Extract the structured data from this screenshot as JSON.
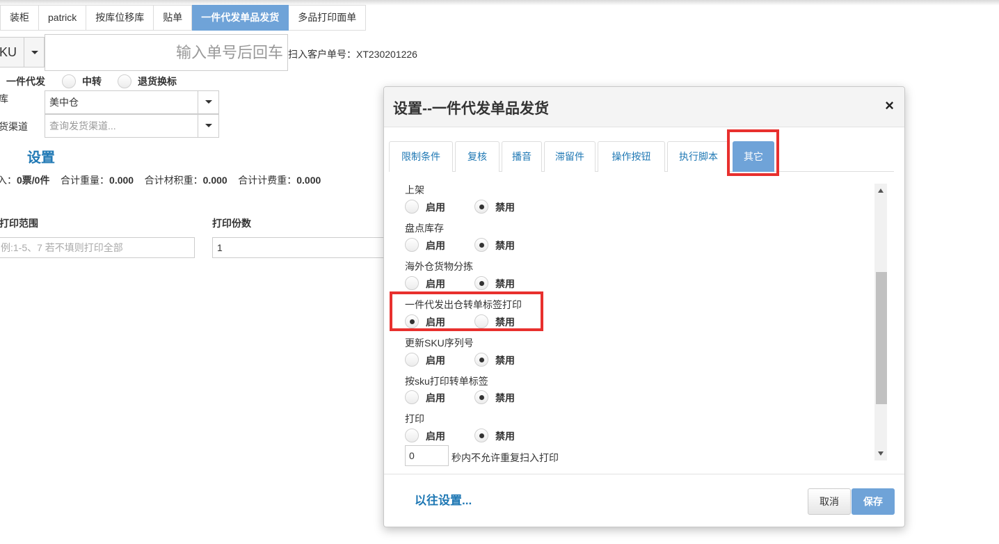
{
  "tabs": [
    {
      "label": "装柜"
    },
    {
      "label": "patrick"
    },
    {
      "label": "按库位移库"
    },
    {
      "label": "贴单"
    },
    {
      "label": "一件代发单品发货",
      "active": true
    },
    {
      "label": "多品打印面单"
    }
  ],
  "scan": {
    "mode_label": "KU",
    "input_placeholder": "输入单号后回车",
    "info": "扫入客户单号：XT230201226"
  },
  "ship_type": {
    "options": [
      {
        "label": "一件代发",
        "selected": true
      },
      {
        "label": "中转",
        "selected": false
      },
      {
        "label": "退货换标",
        "selected": false
      }
    ]
  },
  "warehouse": {
    "label": "库",
    "value": "美中仓"
  },
  "channel": {
    "label": "货渠道",
    "placeholder": "查询发货渠道..."
  },
  "settings_link": "设置",
  "stats": {
    "prefix": "入：",
    "count": "0票/0件",
    "weight_label": "合计重量：",
    "weight": "0.000",
    "material_label": "合计材积重：",
    "material": "0.000",
    "billing_label": "合计计费重：",
    "billing": "0.000"
  },
  "print": {
    "range_label": "打印范围",
    "range_placeholder": "例:1-5、7 若不填则打印全部",
    "copies_label": "打印份数",
    "copies_value": "1"
  },
  "modal": {
    "title": "设置--一件代发单品发货",
    "close": "×",
    "tabs": [
      {
        "label": "限制条件"
      },
      {
        "label": "复核"
      },
      {
        "label": "播音"
      },
      {
        "label": "滞留件"
      },
      {
        "label": "操作按钮"
      },
      {
        "label": "执行脚本"
      },
      {
        "label": "其它",
        "active": true
      }
    ],
    "enable_label": "启用",
    "disable_label": "禁用",
    "settings": [
      {
        "title": "上架",
        "enabled": false
      },
      {
        "title": "盘点库存",
        "enabled": false
      },
      {
        "title": "海外仓货物分拣",
        "enabled": false
      },
      {
        "title": "一件代发出仓转单标签打印",
        "enabled": true
      },
      {
        "title": "更新SKU序列号",
        "enabled": false
      },
      {
        "title": "按sku打印转单标签",
        "enabled": false
      },
      {
        "title": "打印",
        "enabled": false
      }
    ],
    "repeat_seconds": "0",
    "repeat_text": "秒内不允许重复扫入打印",
    "previous_settings": "以往设置...",
    "cancel": "取消",
    "save": "保存"
  },
  "colors": {
    "accent": "#6fa3d8",
    "link": "#1f78b4",
    "highlight": "#e8302e"
  }
}
